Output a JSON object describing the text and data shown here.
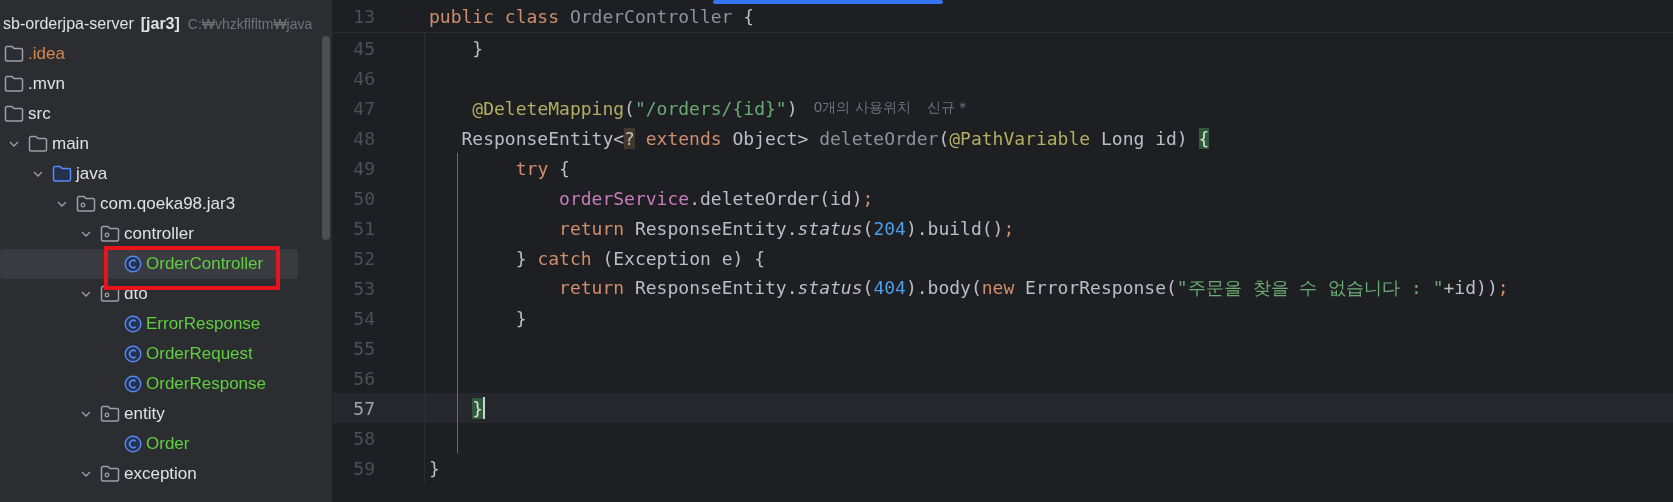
{
  "project_tree": {
    "root": {
      "name": "sb-orderjpa-server",
      "module": "[jar3]",
      "path": "C:₩vhzkflfltm₩java"
    },
    "items": [
      {
        "name": ".idea",
        "kind": "folder",
        "color": "#d5894f",
        "selected": false
      },
      {
        "name": ".mvn",
        "kind": "folder",
        "selected": false
      },
      {
        "name": "src",
        "kind": "folder",
        "selected": false,
        "children": [
          {
            "name": "main",
            "kind": "folder",
            "expanded": true,
            "selected": false,
            "children": [
              {
                "name": "java",
                "kind": "source-folder",
                "expanded": true,
                "selected": false,
                "children": [
                  {
                    "name": "com.qoeka98.jar3",
                    "kind": "package",
                    "expanded": true,
                    "selected": false,
                    "children": [
                      {
                        "name": "controller",
                        "kind": "package",
                        "expanded": true,
                        "selected": false,
                        "children": [
                          {
                            "name": "OrderController",
                            "kind": "class",
                            "color": "#5fcf3f",
                            "selected": true
                          }
                        ]
                      },
                      {
                        "name": "dto",
                        "kind": "package",
                        "expanded": true,
                        "selected": false,
                        "children": [
                          {
                            "name": "ErrorResponse",
                            "kind": "class",
                            "color": "#5fcf3f",
                            "selected": false
                          },
                          {
                            "name": "OrderRequest",
                            "kind": "class",
                            "color": "#5fcf3f",
                            "selected": false
                          },
                          {
                            "name": "OrderResponse",
                            "kind": "class",
                            "color": "#5fcf3f",
                            "selected": false
                          }
                        ]
                      },
                      {
                        "name": "entity",
                        "kind": "package",
                        "expanded": true,
                        "selected": false,
                        "children": [
                          {
                            "name": "Order",
                            "kind": "class",
                            "color": "#5fcf3f",
                            "selected": false
                          }
                        ]
                      },
                      {
                        "name": "exception",
                        "kind": "package",
                        "expanded": true,
                        "selected": false
                      }
                    ]
                  }
                ]
              }
            ]
          }
        ]
      }
    ]
  },
  "editor": {
    "sticky_line": {
      "number": "13",
      "tokens": [
        {
          "kind": "keyword",
          "text": "public class "
        },
        {
          "kind": "unused",
          "text": "OrderController"
        },
        {
          "kind": "plain",
          "text": " {"
        }
      ]
    },
    "lines": [
      {
        "number": "45",
        "kind": "member",
        "current": false,
        "changed": false,
        "tokens": [
          {
            "kind": "plain",
            "text": "}"
          }
        ]
      },
      {
        "number": "46",
        "kind": "top",
        "current": false,
        "changed": false
      },
      {
        "number": "47",
        "kind": "member",
        "current": false,
        "changed": false,
        "tokens": [
          {
            "kind": "annotation",
            "text": "@DeleteMapping"
          },
          {
            "kind": "plain",
            "text": "("
          },
          {
            "kind": "string",
            "text": "\"/orders/{id}\""
          },
          {
            "kind": "plain",
            "text": ")"
          }
        ],
        "hints": [
          "0개의 사용위치",
          "신규 *"
        ]
      },
      {
        "number": "48",
        "kind": "signature",
        "current": false,
        "changed": false,
        "tokens": [
          {
            "kind": "plain",
            "text": "ResponseEntity<"
          },
          {
            "kind": "match",
            "text": "?"
          },
          {
            "kind": "keyword",
            "text": " extends"
          },
          {
            "kind": "plain",
            "text": " Object> "
          },
          {
            "kind": "unused",
            "text": "deleteOrder"
          },
          {
            "kind": "plain",
            "text": "("
          },
          {
            "kind": "annotation",
            "text": "@PathVariable"
          },
          {
            "kind": "plain",
            "text": " Long id) "
          },
          {
            "kind": "brace",
            "text": "{"
          }
        ]
      },
      {
        "number": "49",
        "kind": "method-body",
        "current": false,
        "changed": true,
        "tokens": [
          {
            "kind": "keyword",
            "text": "try"
          },
          {
            "kind": "plain",
            "text": " {"
          }
        ]
      },
      {
        "number": "50",
        "kind": "block-body",
        "current": false,
        "changed": true,
        "tokens": [
          {
            "kind": "field",
            "text": "orderService"
          },
          {
            "kind": "plain",
            "text": ".deleteOrder(id)"
          },
          {
            "kind": "keyword",
            "text": ";"
          }
        ]
      },
      {
        "number": "51",
        "kind": "block-body",
        "current": false,
        "changed": true,
        "tokens": [
          {
            "kind": "keyword",
            "text": "return"
          },
          {
            "kind": "plain",
            "text": " ResponseEntity."
          },
          {
            "kind": "static",
            "text": "status"
          },
          {
            "kind": "plain",
            "text": "("
          },
          {
            "kind": "number",
            "text": "204"
          },
          {
            "kind": "plain",
            "text": ").build()"
          },
          {
            "kind": "keyword",
            "text": ";"
          }
        ]
      },
      {
        "number": "52",
        "kind": "method-body",
        "current": false,
        "changed": true,
        "tokens": [
          {
            "kind": "plain",
            "text": "} "
          },
          {
            "kind": "keyword",
            "text": "catch"
          },
          {
            "kind": "plain",
            "text": " (Exception e) {"
          }
        ]
      },
      {
        "number": "53",
        "kind": "block-body",
        "current": false,
        "changed": true,
        "tokens": [
          {
            "kind": "keyword",
            "text": "return"
          },
          {
            "kind": "plain",
            "text": " ResponseEntity."
          },
          {
            "kind": "static",
            "text": "status"
          },
          {
            "kind": "plain",
            "text": "("
          },
          {
            "kind": "number",
            "text": "404"
          },
          {
            "kind": "plain",
            "text": ").body("
          },
          {
            "kind": "keyword",
            "text": "new"
          },
          {
            "kind": "plain",
            "text": " ErrorResponse("
          },
          {
            "kind": "string",
            "text": "\"주문을 찾을 수 없습니다 : \""
          },
          {
            "kind": "plain",
            "text": "+id))"
          },
          {
            "kind": "keyword",
            "text": ";"
          }
        ]
      },
      {
        "number": "54",
        "kind": "method-body",
        "current": false,
        "changed": true,
        "tokens": [
          {
            "kind": "plain",
            "text": "}"
          }
        ]
      },
      {
        "number": "55",
        "kind": "top",
        "current": false,
        "changed": true
      },
      {
        "number": "56",
        "kind": "top",
        "current": false,
        "changed": true
      },
      {
        "number": "57",
        "kind": "member",
        "current": true,
        "changed": true,
        "tokens": [
          {
            "kind": "brace",
            "text": "}"
          }
        ]
      },
      {
        "number": "58",
        "kind": "top",
        "current": false,
        "changed": true
      },
      {
        "number": "59",
        "kind": "top",
        "current": false,
        "changed": false,
        "tokens": [
          {
            "kind": "plain",
            "text": "}"
          }
        ]
      }
    ]
  }
}
